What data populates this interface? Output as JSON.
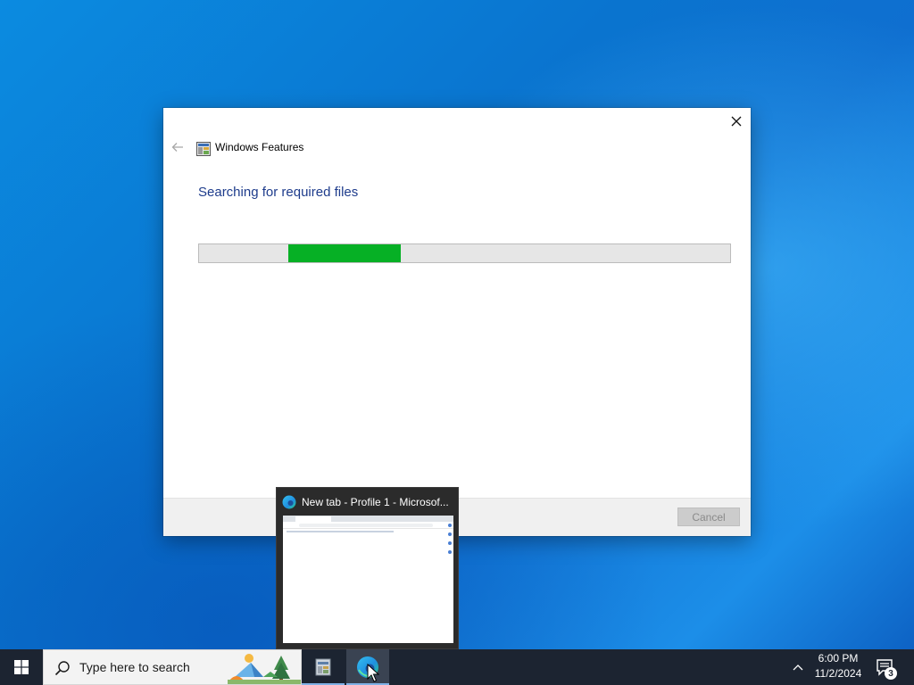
{
  "dialog": {
    "title": "Windows Features",
    "heading": "Searching for required files",
    "progress": {
      "fill_start_fraction": 0.168,
      "fill_end_fraction": 0.38,
      "fill_color": "#06b025"
    },
    "cancel_label": "Cancel",
    "icons": {
      "close": "close-icon",
      "back": "back-arrow-icon",
      "app": "windows-features-icon"
    }
  },
  "taskbar_preview": {
    "title": "New tab - Profile 1 - Microsof...",
    "icon": "edge-icon"
  },
  "taskbar": {
    "search_placeholder": "Type here to search",
    "apps": [
      {
        "name": "windows-features",
        "icon": "windows-features-icon"
      },
      {
        "name": "microsoft-edge",
        "icon": "edge-icon",
        "active": true
      }
    ],
    "clock": {
      "time": "6:00 PM",
      "date": "11/2/2024"
    },
    "notification_count": "3",
    "accent_color": "#1c2431"
  },
  "colors": {
    "heading": "#1e3c8c",
    "progress_fill": "#06b025",
    "desktop": "#0f7ad6"
  }
}
